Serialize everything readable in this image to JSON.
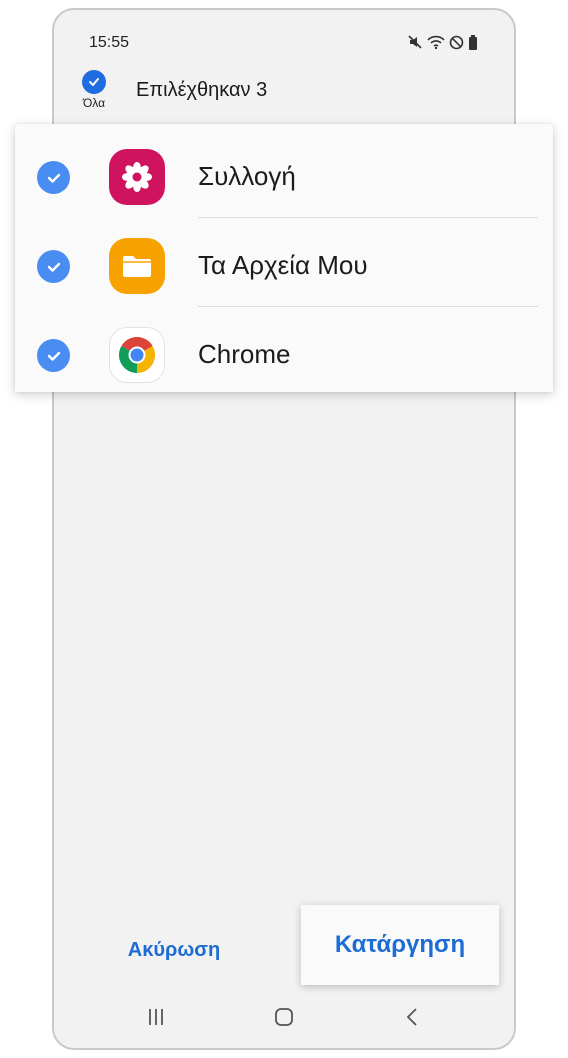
{
  "status_bar": {
    "time": "15:55",
    "icons": [
      "mute-icon",
      "wifi-icon",
      "do-not-disturb-icon",
      "battery-icon"
    ]
  },
  "header": {
    "select_all_label": "Όλα",
    "selected_count": "Επιλέχθηκαν 3"
  },
  "apps": [
    {
      "name": "Συλλογή",
      "icon": "gallery-icon",
      "checked": true
    },
    {
      "name": "Τα Αρχεία Μου",
      "icon": "my-files-icon",
      "checked": true
    },
    {
      "name": "Chrome",
      "icon": "chrome-icon",
      "checked": true
    }
  ],
  "actions": {
    "cancel_label": "Ακύρωση",
    "remove_label": "Κατάργηση"
  },
  "nav": {
    "buttons": [
      "recents-icon",
      "home-icon",
      "back-icon"
    ]
  },
  "colors": {
    "accent": "#1c6cd4",
    "check": "#4a8df2",
    "gallery": "#d0135f",
    "files": "#f8a200",
    "background": "#f2f2f2"
  }
}
